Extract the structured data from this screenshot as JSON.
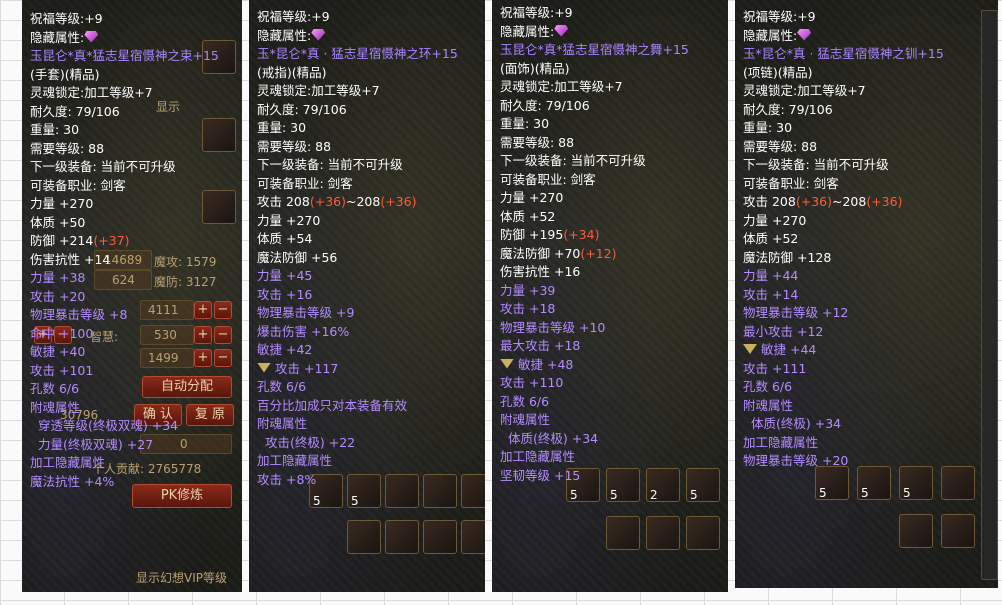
{
  "panel1": {
    "line_blessing": "祝福等级:+9",
    "line_hidden": "隐藏属性:",
    "item_name": "玉昆仑*真*猛志星宿慑神之束+15",
    "item_type": "(手套)(精品)",
    "soul_lock": "灵魂锁定:加工等级+7",
    "durability": "耐久度: 79/106",
    "weight": "重量: 30",
    "req_level": "需要等级: 88",
    "next_equip": "下一级装备: 当前不可升级",
    "job": "可装备职业: 剑客",
    "base": [
      {
        "label": "力量 +270",
        "extra": ""
      },
      {
        "label": "体质 +50",
        "extra": ""
      },
      {
        "label": "防御 +214",
        "extra": "(+37)"
      },
      {
        "label": "伤害抗性 +14",
        "extra": ""
      }
    ],
    "purple": [
      "力量 +38",
      "攻击 +20",
      "物理暴击等级 +8",
      "命中 +100",
      "敏捷 +40",
      "攻击 +101",
      "孔数 6/6"
    ],
    "soul_title": "附魂属性",
    "soul_items": [
      "穿透等级(终极双魂) +34",
      "力量(终极双魂) +27"
    ],
    "craft_title": "加工隐藏属性",
    "craft_items": [
      "魔法抗性 +4%"
    ],
    "bg": {
      "stats": [
        "14689",
        "624",
        "4111",
        "530",
        "1499",
        "30796",
        "0"
      ],
      "labels": [
        "魔攻: 1579",
        "魔防: 3127",
        "智慧:",
        "自动分配",
        "确 认",
        "复 原",
        "个人贡献: 2765778",
        "PK修炼",
        "显示幻想VIP等级",
        "显示"
      ]
    }
  },
  "panel2": {
    "line_blessing": "祝福等级:+9",
    "line_hidden": "隐藏属性:",
    "item_name": "玉*昆仑*真 · 猛志星宿慑神之环+15",
    "item_type": "(戒指)(精品)",
    "soul_lock": "灵魂锁定:加工等级+7",
    "durability": "耐久度: 79/106",
    "weight": "重量: 30",
    "req_level": "需要等级: 88",
    "next_equip": "下一级装备: 当前不可升级",
    "job": "可装备职业: 剑客",
    "attack_a": "攻击 208",
    "attack_a_extra": "(+36)",
    "attack_b": "~208",
    "attack_b_extra": "(+36)",
    "base": [
      "力量 +270",
      "体质 +54",
      "魔法防御 +56"
    ],
    "purple": [
      "力量 +45",
      "攻击 +16",
      "物理暴击等级 +9",
      "爆击伤害 +16%",
      "敏捷 +42",
      "攻击 +117",
      "孔数 6/6"
    ],
    "percent_note": "百分比加成只对本装备有效",
    "soul_title": "附魂属性",
    "soul_items": [
      "攻击(终极) +22"
    ],
    "craft_title": "加工隐藏属性",
    "craft_items": [
      "攻击 +8%"
    ],
    "slots": [
      "5",
      "5"
    ]
  },
  "panel3": {
    "line_blessing": "祝福等级:+9",
    "line_hidden": "隐藏属性:",
    "item_name": "玉昆仑*真*猛志星宿慑神之舞+15",
    "item_type": "(面饰)(精品)",
    "soul_lock": "灵魂锁定:加工等级+7",
    "durability": "耐久度: 79/106",
    "weight": "重量: 30",
    "req_level": "需要等级: 88",
    "next_equip": "下一级装备: 当前不可升级",
    "job": "可装备职业: 剑客",
    "base": [
      {
        "label": "力量 +270",
        "extra": ""
      },
      {
        "label": "体质 +52",
        "extra": ""
      },
      {
        "label": "防御 +195",
        "extra": "(+34)"
      },
      {
        "label": "魔法防御 +70",
        "extra": "(+12)"
      },
      {
        "label": "伤害抗性 +16",
        "extra": ""
      }
    ],
    "purple": [
      "力量 +39",
      "攻击 +18",
      "物理暴击等级 +10",
      "最大攻击 +18",
      "敏捷 +48",
      "攻击 +110",
      "孔数 6/6"
    ],
    "soul_title": "附魂属性",
    "soul_items": [
      "体质(终极) +34"
    ],
    "craft_title": "加工隐藏属性",
    "craft_items": [
      "坚韧等级 +15"
    ],
    "slots": [
      "5",
      "5",
      "2",
      "5"
    ]
  },
  "panel4": {
    "line_blessing": "祝福等级:+9",
    "line_hidden": "隐藏属性:",
    "item_name": "玉*昆仑*真 · 猛志星宿慑神之钏+15",
    "item_type": "(项链)(精品)",
    "soul_lock": "灵魂锁定:加工等级+7",
    "durability": "耐久度: 79/106",
    "weight": "重量: 30",
    "req_level": "需要等级: 88",
    "next_equip": "下一级装备: 当前不可升级",
    "job": "可装备职业: 剑客",
    "attack_a": "攻击 208",
    "attack_a_extra": "(+36)",
    "attack_b": "~208",
    "attack_b_extra": "(+36)",
    "base": [
      "力量 +270",
      "体质 +52",
      "魔法防御 +128"
    ],
    "purple": [
      "力量 +44",
      "攻击 +14",
      "物理暴击等级 +12",
      "最小攻击 +12",
      "敏捷 +44",
      "攻击 +111",
      "孔数 6/6"
    ],
    "soul_title": "附魂属性",
    "soul_items": [
      "体质(终极) +34"
    ],
    "craft_title": "加工隐藏属性",
    "craft_items": [
      "物理暴击等级 +20"
    ],
    "slots": [
      "5",
      "5",
      "5"
    ]
  },
  "colors": {
    "purple_text": "#b48cff",
    "item_name": "#a885ff",
    "bonus_red": "#ff5a3a",
    "tooltip_bg": "#000000"
  },
  "icons": [
    "gem-icon",
    "heart-icon"
  ]
}
